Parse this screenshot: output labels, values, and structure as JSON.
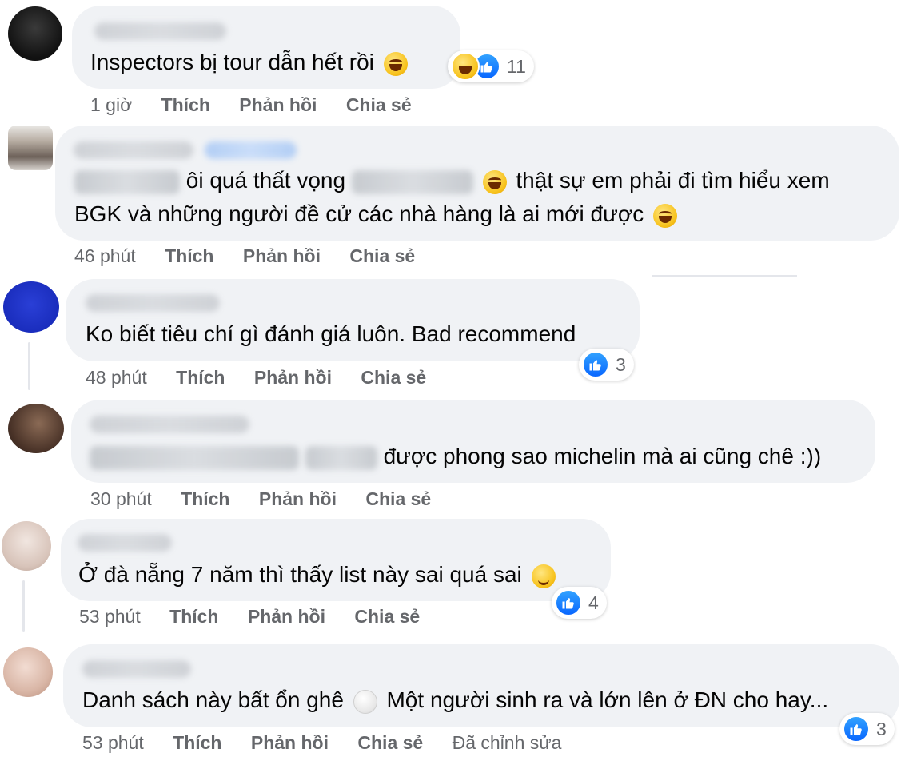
{
  "colors": {
    "bubble": "#f0f2f5",
    "secondary_text": "#65676b",
    "like_blue": "#0866ff"
  },
  "comments": [
    {
      "text": "Inspectors bị tour dẫn hết rồi",
      "time": "1 giờ",
      "like_label": "Thích",
      "reply_label": "Phản hồi",
      "share_label": "Chia sẻ",
      "reactions": [
        "haha-icon",
        "like-icon"
      ],
      "reaction_count": "11"
    },
    {
      "text_line1_a": "ôi quá thất vọng",
      "text_line1_b": "thật sự em phải đi tìm hiểu xem",
      "text_line2": "BGK và những người đề cử các nhà hàng là ai mới được",
      "time": "46 phút",
      "like_label": "Thích",
      "reply_label": "Phản hồi",
      "share_label": "Chia sẻ"
    },
    {
      "text": "Ko biết tiêu chí gì đánh giá luôn. Bad recommend",
      "time": "48 phút",
      "like_label": "Thích",
      "reply_label": "Phản hồi",
      "share_label": "Chia sẻ",
      "reaction_count": "3"
    },
    {
      "text": "được phong sao michelin mà ai cũng chê :))",
      "time": "30 phút",
      "like_label": "Thích",
      "reply_label": "Phản hồi",
      "share_label": "Chia sẻ"
    },
    {
      "text": "Ở đà nẵng 7 năm thì thấy list này sai quá sai",
      "time": "53 phút",
      "like_label": "Thích",
      "reply_label": "Phản hồi",
      "share_label": "Chia sẻ",
      "reaction_count": "4"
    },
    {
      "text_a": "Danh sách này bất ổn ghê",
      "text_b": "Một người sinh ra và lớn lên ở ĐN cho hay...",
      "time": "53 phút",
      "like_label": "Thích",
      "reply_label": "Phản hồi",
      "share_label": "Chia sẻ",
      "edited_label": "Đã chỉnh sửa",
      "reaction_count": "3"
    }
  ]
}
